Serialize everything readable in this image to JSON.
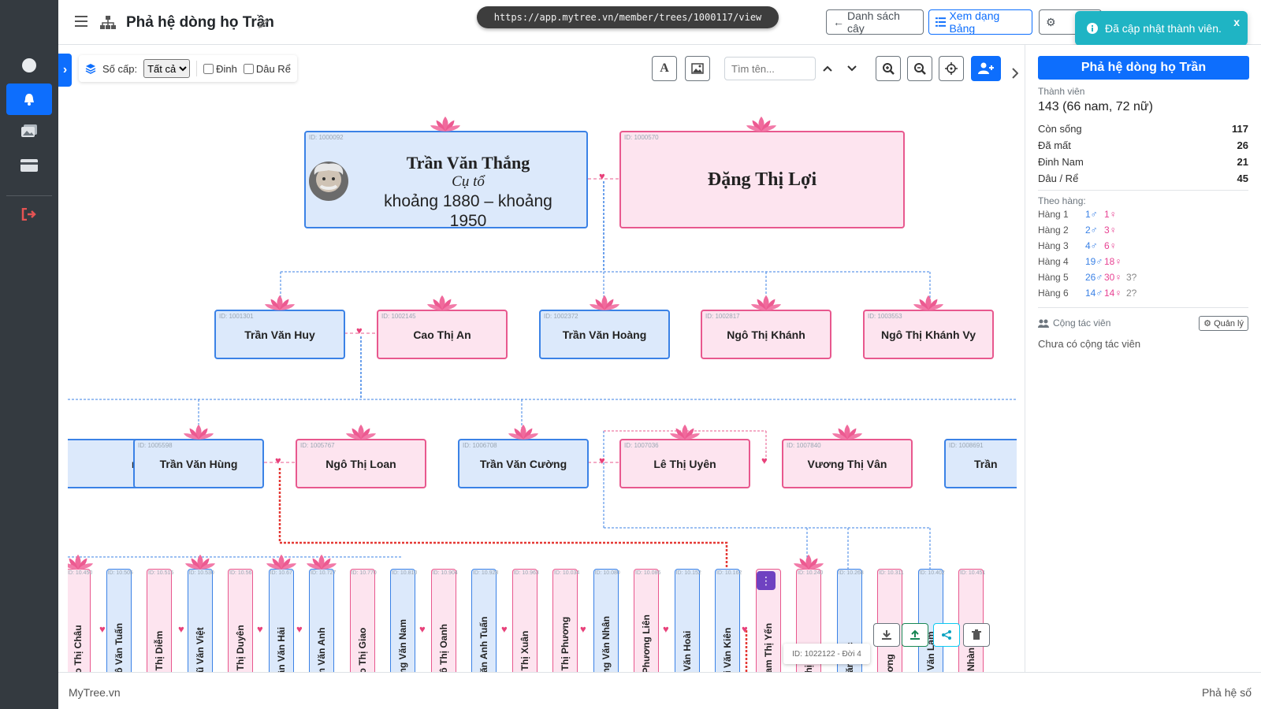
{
  "browser": {
    "url": "https://app.mytree.vn/member/trees/1000117/view"
  },
  "header": {
    "title": "Phả hệ dòng họ Trần",
    "btn_list": "Danh sách cây",
    "btn_table": "Xem dạng Bảng"
  },
  "toast": {
    "message": "Đã cập nhật thành viên.",
    "close": "x"
  },
  "toolbar": {
    "level_label": "Số cấp:",
    "level_value": "Tất cả",
    "filter_dinh": "Đinh",
    "filter_dau_re": "Dâu Rể",
    "search_placeholder": "Tìm tên...",
    "font_btn": "A"
  },
  "tree": {
    "root_male": {
      "id": "ID: 1000092",
      "name": "Trần Văn Thắng",
      "title": "Cụ tổ",
      "years": "khoảng 1880 – khoảng 1950"
    },
    "root_female": {
      "id": "ID: 1000570",
      "name": "Đặng Thị Lợi"
    },
    "gen2": [
      {
        "id": "ID: 1001301",
        "name": "Trần Văn Huy",
        "gender": "male"
      },
      {
        "id": "ID: 1002145",
        "name": "Cao Thị An",
        "gender": "female"
      },
      {
        "id": "ID: 1002372",
        "name": "Trần Văn Hoàng",
        "gender": "male"
      },
      {
        "id": "ID: 1002817",
        "name": "Ngô Thị Khánh",
        "gender": "female"
      },
      {
        "id": "ID: 1003553",
        "name": "Ngô Thị Khánh Vy",
        "gender": "female"
      }
    ],
    "gen3": [
      {
        "id": "",
        "name": "nh",
        "gender": "male"
      },
      {
        "id": "ID: 1005598",
        "name": "Trần Văn Hùng",
        "gender": "male"
      },
      {
        "id": "ID: 1005767",
        "name": "Ngô Thị Loan",
        "gender": "female"
      },
      {
        "id": "ID: 1006708",
        "name": "Trần Văn Cường",
        "gender": "male"
      },
      {
        "id": "ID: 1007036",
        "name": "Lê Thị Uyên",
        "gender": "female"
      },
      {
        "id": "ID: 1007840",
        "name": "Vương Thị Vân",
        "gender": "female"
      },
      {
        "id": "ID: 1008691",
        "name": "Trần",
        "gender": "male"
      }
    ],
    "gen4": [
      {
        "name": "ao Thị Châu",
        "id": "ID: 10.450",
        "gender": "female"
      },
      {
        "name": "gô Văn Tuấn",
        "id": "ID: 10.505",
        "gender": "male"
      },
      {
        "name": "o Thị Diễm",
        "id": "ID: 10.515",
        "gender": "female"
      },
      {
        "name": "Vũ Văn Việt",
        "id": "ID: 10.530",
        "gender": "male"
      },
      {
        "name": "o Thị Duyên",
        "id": "ID: 10.56",
        "gender": "female"
      },
      {
        "name": "rần Văn Hải",
        "id": "ID: 10.67",
        "gender": "male"
      },
      {
        "name": "ần Văn Anh",
        "id": "ID: 10.727",
        "gender": "male"
      },
      {
        "name": "ao Thị Giao",
        "id": "ID: 10.770",
        "gender": "female"
      },
      {
        "name": "ăng Văn Nam",
        "id": "ID: 10.810",
        "gender": "male"
      },
      {
        "name": "gô Thị Oanh",
        "id": "ID: 10.904",
        "gender": "female"
      },
      {
        "name": "Văn Anh Tuấn",
        "id": "ID: 10.928",
        "gender": "male"
      },
      {
        "name": "ô Thị Xuân",
        "id": "ID: 10.963",
        "gender": "female"
      },
      {
        "name": "o Thị Phương",
        "id": "ID: 10.034",
        "gender": "female"
      },
      {
        "name": "ăng Văn Nhân",
        "id": "ID: 10.080",
        "gender": "male"
      },
      {
        "name": "i Phương Liên",
        "id": "ID: 10.086",
        "gender": "female"
      },
      {
        "name": "ạ Văn Hoài",
        "id": "ID: 10.152",
        "gender": "male"
      },
      {
        "name": "ùi Văn Kiên",
        "id": "ID: 10.162",
        "gender": "male"
      },
      {
        "name": "ham Thị Yến",
        "id": "",
        "gender": "female"
      },
      {
        "name": "Thị Anh",
        "id": "ID: 10.240",
        "gender": "female"
      },
      {
        "name": "Văn Lộc",
        "id": "ID: 10.268",
        "gender": "male"
      },
      {
        "name": "ương",
        "id": "ID: 10.311",
        "gender": "female"
      },
      {
        "name": "ũ Văn Lâm",
        "id": "ID: 10.402",
        "gender": "male"
      },
      {
        "name": "y Nhàn",
        "id": "ID: 10.451",
        "gender": "female"
      }
    ],
    "tooltip": "ID: 1022122 - Đời 4"
  },
  "panel": {
    "title": "Phả hệ dòng họ Trần",
    "members_label": "Thành viên",
    "members_value": "143 (66 nam, 72 nữ)",
    "stats": [
      {
        "label": "Còn sống",
        "value": "117"
      },
      {
        "label": "Đã mất",
        "value": "26"
      },
      {
        "label": "Đinh Nam",
        "value": "21"
      },
      {
        "label": "Dâu / Rể",
        "value": "45"
      }
    ],
    "by_rank_label": "Theo hàng:",
    "ranks": [
      {
        "label": "Hàng 1",
        "m": "1♂",
        "f": "1♀",
        "u": ""
      },
      {
        "label": "Hàng 2",
        "m": "2♂",
        "f": "3♀",
        "u": ""
      },
      {
        "label": "Hàng 3",
        "m": "4♂",
        "f": "6♀",
        "u": ""
      },
      {
        "label": "Hàng 4",
        "m": "19♂",
        "f": "18♀",
        "u": ""
      },
      {
        "label": "Hàng 5",
        "m": "26♂",
        "f": "30♀",
        "u": "3?"
      },
      {
        "label": "Hàng 6",
        "m": "14♂",
        "f": "14♀",
        "u": "2?"
      }
    ],
    "collab_label": "Cộng tác viên",
    "collab_manage": "Quản lý",
    "collab_empty": "Chưa có cộng tác viên"
  },
  "footer": {
    "left": "MyTree.vn",
    "right": "Phả hệ số"
  },
  "colors": {
    "male_bg": "#dce9fb",
    "male_border": "#3b82e6",
    "female_bg": "#fde4ef",
    "female_border": "#e8588e",
    "accent": "#0d6efd",
    "toast": "#1fb4c4"
  }
}
